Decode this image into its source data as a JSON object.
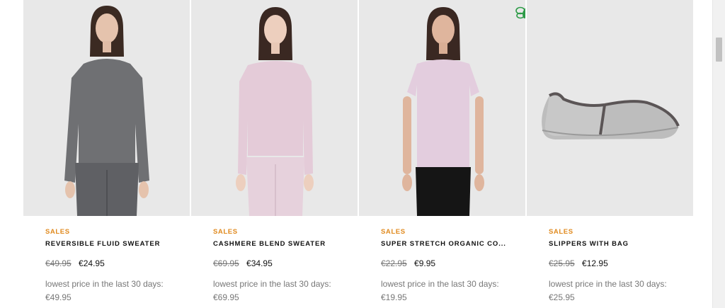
{
  "products": [
    {
      "badge": "SALES",
      "name": "REVERSIBLE FLUID SWEATER",
      "old_price": "€49.95",
      "new_price": "€24.95",
      "lowest_label": "lowest price in the last 30 days:",
      "lowest_price": "€49.95",
      "image": "grey-sweater-model"
    },
    {
      "badge": "SALES",
      "name": "CASHMERE BLEND SWEATER",
      "old_price": "€69.95",
      "new_price": "€34.95",
      "lowest_label": "lowest price in the last 30 days:",
      "lowest_price": "€69.95",
      "image": "pink-sweater-model"
    },
    {
      "badge": "SALES",
      "name": "SUPER STRETCH ORGANIC CO...",
      "old_price": "€22.95",
      "new_price": "€9.95",
      "lowest_label": "lowest price in the last 30 days:",
      "lowest_price": "€19.95",
      "image": "pink-tshirt-model",
      "eco_icon": "bee-icon"
    },
    {
      "badge": "SALES",
      "name": "SLIPPERS WITH BAG",
      "old_price": "€25.95",
      "new_price": "€12.95",
      "lowest_label": "lowest price in the last 30 days:",
      "lowest_price": "€25.95",
      "image": "grey-slipper"
    }
  ],
  "colors": {
    "sales_badge": "#e08a1e",
    "eco_icon": "#2e9b48",
    "image_background": "#e8e8e8"
  }
}
